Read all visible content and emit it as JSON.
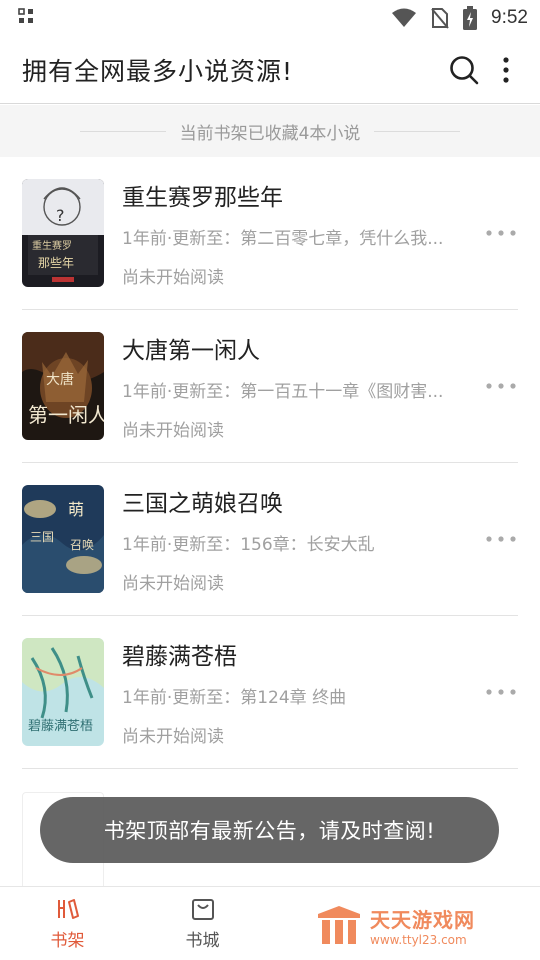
{
  "status_bar": {
    "time": "9:52"
  },
  "header": {
    "title": "拥有全网最多小说资源!"
  },
  "shelf": {
    "info": "当前书架已收藏4本小说"
  },
  "books": [
    {
      "title": "重生赛罗那些年",
      "update": "1年前·更新至：第二百零七章，凭什么我...",
      "status": "尚未开始阅读"
    },
    {
      "title": "大唐第一闲人",
      "update": "1年前·更新至：第一百五十一章《图财害...",
      "status": "尚未开始阅读"
    },
    {
      "title": "三国之萌娘召唤",
      "update": "1年前·更新至：156章：长安大乱",
      "status": "尚未开始阅读"
    },
    {
      "title": "碧藤满苍梧",
      "update": "1年前·更新至：第124章 终曲",
      "status": "尚未开始阅读"
    }
  ],
  "toast": {
    "message": "书架顶部有最新公告，请及时查阅!"
  },
  "bottom_nav": {
    "bookshelf": "书架",
    "bookstore": "书城"
  },
  "watermark": {
    "name": "天天游戏网",
    "url": "www.ttyl23.com"
  },
  "colors": {
    "accent": "#e05a3a",
    "toast_bg": "#5a5a5a",
    "watermark": "#f08a5d"
  },
  "icons": [
    "apps-icon",
    "wifi-icon",
    "no-sim-icon",
    "battery-charging-icon",
    "search-icon",
    "more-vert-icon",
    "more-horiz-icon",
    "bookshelf-icon",
    "bookstore-bag-icon"
  ]
}
